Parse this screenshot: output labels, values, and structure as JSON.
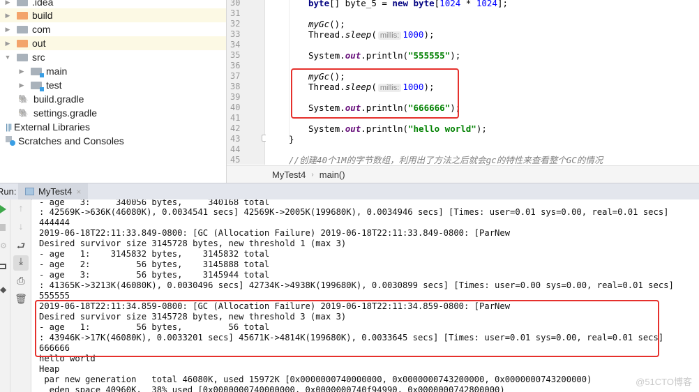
{
  "project_tree": {
    "items": [
      {
        "label": ".idea",
        "icon": "folder-grey-icon",
        "arrow": "▶"
      },
      {
        "label": "build",
        "icon": "folder-orange-icon",
        "arrow": "▶"
      },
      {
        "label": "com",
        "icon": "folder-grey-icon",
        "arrow": "▶"
      },
      {
        "label": "out",
        "icon": "folder-orange-icon",
        "arrow": "▶"
      },
      {
        "label": "src",
        "icon": "folder-grey-icon",
        "arrow": "▼"
      },
      {
        "label": "main",
        "icon": "source-folder-icon",
        "arrow": "▶"
      },
      {
        "label": "test",
        "icon": "test-folder-icon",
        "arrow": "▶"
      },
      {
        "label": "build.gradle",
        "icon": "gradle-icon"
      },
      {
        "label": "settings.gradle",
        "icon": "gradle-icon"
      },
      {
        "label": "External Libraries",
        "icon": "libraries-icon"
      },
      {
        "label": "Scratches and Consoles",
        "icon": "scratches-icon"
      }
    ]
  },
  "editor": {
    "line_numbers": [
      "30",
      "31",
      "32",
      "33",
      "34",
      "35",
      "36",
      "37",
      "38",
      "39",
      "40",
      "41",
      "42",
      "43",
      "44",
      "45"
    ],
    "code": {
      "l30_kw1": "byte",
      "l30_a": "[] byte_5 = ",
      "l30_kw2": "new",
      "l30_kw3": "byte",
      "l30_b": "[",
      "l30_n1": "1024",
      "l30_c": " * ",
      "l30_n2": "1024",
      "l30_d": "];",
      "mygc": "myGc",
      "paren_semi": "();",
      "thread": "Thread.",
      "sleep": "sleep",
      "open": "(",
      "hint": "millis:",
      "sleep_val": "1000",
      "close": ");",
      "system": "System.",
      "out": "out",
      "println": ".println(",
      "str1": "\"555555\"",
      "str2": "\"666666\"",
      "str3": "\"hello world\"",
      "brace": "}",
      "comment": "//创建40个1M的字节数组，利用出了方法之后就会gc的特性来查看整个GC的情况"
    }
  },
  "breadcrumb": {
    "class": "MyTest4",
    "separator": "›",
    "method": "main()"
  },
  "run_panel": {
    "label": "Run:",
    "tab": "MyTest4",
    "tab_close": "×",
    "console_lines": [
      "- age   3:     340056 bytes,     340168 total",
      ": 42569K->636K(46080K), 0.0034541 secs] 42569K->2005K(199680K), 0.0034946 secs] [Times: user=0.01 sys=0.00, real=0.01 secs]",
      "444444",
      "2019-06-18T22:11:33.849-0800: [GC (Allocation Failure) 2019-06-18T22:11:33.849-0800: [ParNew",
      "Desired survivor size 3145728 bytes, new threshold 1 (max 3)",
      "- age   1:    3145832 bytes,    3145832 total",
      "- age   2:         56 bytes,    3145888 total",
      "- age   3:         56 bytes,    3145944 total",
      ": 41365K->3213K(46080K), 0.0030496 secs] 42734K->4938K(199680K), 0.0030899 secs] [Times: user=0.00 sys=0.00, real=0.01 secs]",
      "555555",
      "2019-06-18T22:11:34.859-0800: [GC (Allocation Failure) 2019-06-18T22:11:34.859-0800: [ParNew",
      "Desired survivor size 3145728 bytes, new threshold 3 (max 3)",
      "- age   1:         56 bytes,         56 total",
      ": 43946K->17K(46080K), 0.0033201 secs] 45671K->4814K(199680K), 0.0033645 secs] [Times: user=0.01 sys=0.00, real=0.01 secs]",
      "666666",
      "hello world",
      "Heap",
      " par new generation   total 46080K, used 15972K [0x0000000740000000, 0x0000000743200000, 0x0000000743200000)",
      "  eden space 40960K,  38% used [0x0000000740000000, 0x0000000740f94990, 0x0000000742800000)"
    ]
  },
  "watermark": "@51CTO博客"
}
